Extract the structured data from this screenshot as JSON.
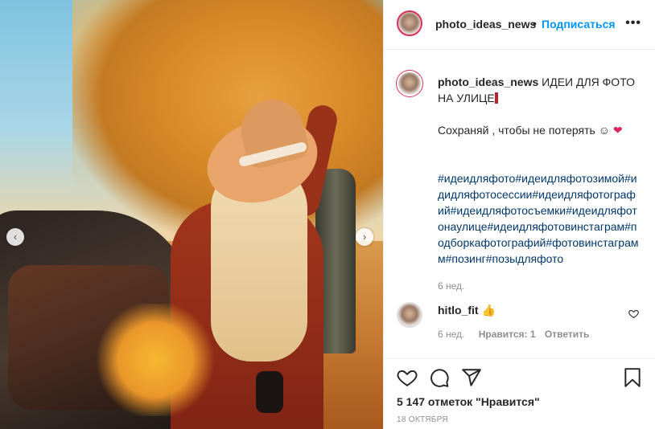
{
  "post": {
    "username": "photo_ideas_news",
    "follow_label": "Подписаться",
    "more_label": "•••",
    "caption_title": "ИДЕИ ДЛЯ ФОТО НА УЛИЦЕ",
    "caption_save": "Сохраняй , чтобы не потерять ☺",
    "hashtags": "#идеидляфото#идеидляфотозимой#идидляфотосессии#идеидляфотографий#идеидляфотосъемки#идеидляфотонаулице#идеидляфотовинстаграм#подборкафотографий#фотовинстаграмм#позинг#позыдляфото",
    "caption_age": "6 нед.",
    "likes": "5 147 отметок \"Нравится\"",
    "date": "18 ОКТЯБРЯ"
  },
  "comment": {
    "username": "hitlo_fit",
    "emoji": "👍",
    "age": "6 нед.",
    "likes": "Нравится: 1",
    "reply_label": "Ответить"
  },
  "carousel": {
    "prev": "‹",
    "next": "›"
  },
  "colors": {
    "accent": "#0095f6",
    "hashtag": "#00376b",
    "muted": "#8e8e8e",
    "red": "#ed4956"
  },
  "icons": [
    "heart-icon",
    "comment-icon",
    "share-icon",
    "bookmark-icon",
    "small-heart-icon",
    "chevron-left-icon",
    "chevron-right-icon",
    "more-icon"
  ]
}
